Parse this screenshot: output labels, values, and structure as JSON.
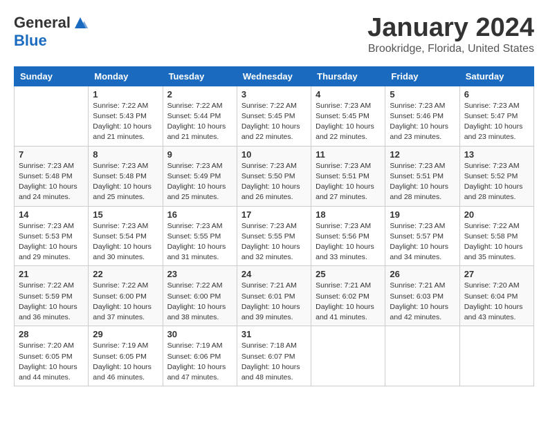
{
  "header": {
    "logo": {
      "general": "General",
      "blue": "Blue"
    },
    "title": "January 2024",
    "location": "Brookridge, Florida, United States"
  },
  "calendar": {
    "days_of_week": [
      "Sunday",
      "Monday",
      "Tuesday",
      "Wednesday",
      "Thursday",
      "Friday",
      "Saturday"
    ],
    "weeks": [
      [
        {
          "day": "",
          "info": ""
        },
        {
          "day": "1",
          "info": "Sunrise: 7:22 AM\nSunset: 5:43 PM\nDaylight: 10 hours\nand 21 minutes."
        },
        {
          "day": "2",
          "info": "Sunrise: 7:22 AM\nSunset: 5:44 PM\nDaylight: 10 hours\nand 21 minutes."
        },
        {
          "day": "3",
          "info": "Sunrise: 7:22 AM\nSunset: 5:45 PM\nDaylight: 10 hours\nand 22 minutes."
        },
        {
          "day": "4",
          "info": "Sunrise: 7:23 AM\nSunset: 5:45 PM\nDaylight: 10 hours\nand 22 minutes."
        },
        {
          "day": "5",
          "info": "Sunrise: 7:23 AM\nSunset: 5:46 PM\nDaylight: 10 hours\nand 23 minutes."
        },
        {
          "day": "6",
          "info": "Sunrise: 7:23 AM\nSunset: 5:47 PM\nDaylight: 10 hours\nand 23 minutes."
        }
      ],
      [
        {
          "day": "7",
          "info": "Sunrise: 7:23 AM\nSunset: 5:48 PM\nDaylight: 10 hours\nand 24 minutes."
        },
        {
          "day": "8",
          "info": "Sunrise: 7:23 AM\nSunset: 5:48 PM\nDaylight: 10 hours\nand 25 minutes."
        },
        {
          "day": "9",
          "info": "Sunrise: 7:23 AM\nSunset: 5:49 PM\nDaylight: 10 hours\nand 25 minutes."
        },
        {
          "day": "10",
          "info": "Sunrise: 7:23 AM\nSunset: 5:50 PM\nDaylight: 10 hours\nand 26 minutes."
        },
        {
          "day": "11",
          "info": "Sunrise: 7:23 AM\nSunset: 5:51 PM\nDaylight: 10 hours\nand 27 minutes."
        },
        {
          "day": "12",
          "info": "Sunrise: 7:23 AM\nSunset: 5:51 PM\nDaylight: 10 hours\nand 28 minutes."
        },
        {
          "day": "13",
          "info": "Sunrise: 7:23 AM\nSunset: 5:52 PM\nDaylight: 10 hours\nand 28 minutes."
        }
      ],
      [
        {
          "day": "14",
          "info": "Sunrise: 7:23 AM\nSunset: 5:53 PM\nDaylight: 10 hours\nand 29 minutes."
        },
        {
          "day": "15",
          "info": "Sunrise: 7:23 AM\nSunset: 5:54 PM\nDaylight: 10 hours\nand 30 minutes."
        },
        {
          "day": "16",
          "info": "Sunrise: 7:23 AM\nSunset: 5:55 PM\nDaylight: 10 hours\nand 31 minutes."
        },
        {
          "day": "17",
          "info": "Sunrise: 7:23 AM\nSunset: 5:55 PM\nDaylight: 10 hours\nand 32 minutes."
        },
        {
          "day": "18",
          "info": "Sunrise: 7:23 AM\nSunset: 5:56 PM\nDaylight: 10 hours\nand 33 minutes."
        },
        {
          "day": "19",
          "info": "Sunrise: 7:23 AM\nSunset: 5:57 PM\nDaylight: 10 hours\nand 34 minutes."
        },
        {
          "day": "20",
          "info": "Sunrise: 7:22 AM\nSunset: 5:58 PM\nDaylight: 10 hours\nand 35 minutes."
        }
      ],
      [
        {
          "day": "21",
          "info": "Sunrise: 7:22 AM\nSunset: 5:59 PM\nDaylight: 10 hours\nand 36 minutes."
        },
        {
          "day": "22",
          "info": "Sunrise: 7:22 AM\nSunset: 6:00 PM\nDaylight: 10 hours\nand 37 minutes."
        },
        {
          "day": "23",
          "info": "Sunrise: 7:22 AM\nSunset: 6:00 PM\nDaylight: 10 hours\nand 38 minutes."
        },
        {
          "day": "24",
          "info": "Sunrise: 7:21 AM\nSunset: 6:01 PM\nDaylight: 10 hours\nand 39 minutes."
        },
        {
          "day": "25",
          "info": "Sunrise: 7:21 AM\nSunset: 6:02 PM\nDaylight: 10 hours\nand 41 minutes."
        },
        {
          "day": "26",
          "info": "Sunrise: 7:21 AM\nSunset: 6:03 PM\nDaylight: 10 hours\nand 42 minutes."
        },
        {
          "day": "27",
          "info": "Sunrise: 7:20 AM\nSunset: 6:04 PM\nDaylight: 10 hours\nand 43 minutes."
        }
      ],
      [
        {
          "day": "28",
          "info": "Sunrise: 7:20 AM\nSunset: 6:05 PM\nDaylight: 10 hours\nand 44 minutes."
        },
        {
          "day": "29",
          "info": "Sunrise: 7:19 AM\nSunset: 6:05 PM\nDaylight: 10 hours\nand 46 minutes."
        },
        {
          "day": "30",
          "info": "Sunrise: 7:19 AM\nSunset: 6:06 PM\nDaylight: 10 hours\nand 47 minutes."
        },
        {
          "day": "31",
          "info": "Sunrise: 7:18 AM\nSunset: 6:07 PM\nDaylight: 10 hours\nand 48 minutes."
        },
        {
          "day": "",
          "info": ""
        },
        {
          "day": "",
          "info": ""
        },
        {
          "day": "",
          "info": ""
        }
      ]
    ]
  }
}
